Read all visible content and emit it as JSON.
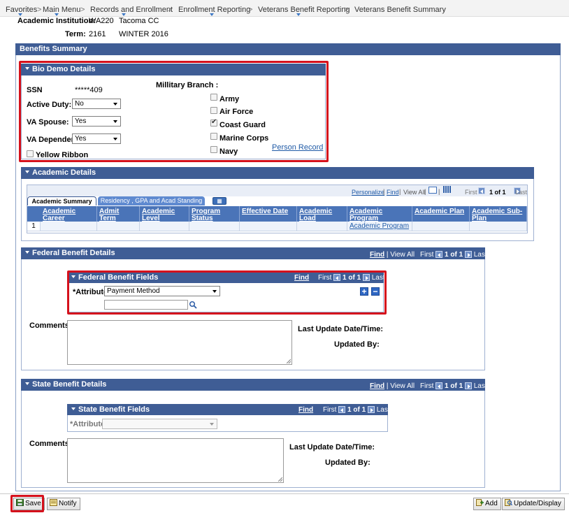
{
  "breadcrumb": {
    "items": [
      "Favorites",
      "Main Menu",
      "Records and Enrollment",
      "Enrollment Reporting",
      "Veterans Benefit Reporting",
      "Veterans Benefit Summary"
    ],
    "separator": ">"
  },
  "header": {
    "institution_label": "Academic Institution:",
    "institution_code": "WA220",
    "institution_name": "Tacoma CC",
    "term_label": "Term:",
    "term_code": "2161",
    "term_name": "WINTER 2016"
  },
  "benefits_summary": {
    "title": "Benefits Summary"
  },
  "bio_demo": {
    "title": "Bio Demo Details",
    "ssn_label": "SSN",
    "ssn_value": "*****409",
    "active_duty_label": "Active Duty:",
    "active_duty_value": "No",
    "va_spouse_label": "VA Spouse:",
    "va_spouse_value": "Yes",
    "va_dependent_label": "VA Dependent:",
    "va_dependent_value": "Yes",
    "yellow_ribbon_label": "Yellow Ribbon",
    "yellow_ribbon_checked": false,
    "military_branch_label": "Millitary Branch :",
    "branches": [
      {
        "label": "Army",
        "checked": false
      },
      {
        "label": "Air Force",
        "checked": false
      },
      {
        "label": "Coast Guard",
        "checked": true
      },
      {
        "label": "Marine Corps",
        "checked": false
      },
      {
        "label": "Navy",
        "checked": false
      }
    ],
    "person_record_link": "Person Record"
  },
  "academic": {
    "title": "Academic Details",
    "toolbar": {
      "personalize": "Personalize",
      "find": "Find",
      "view_all": "View All",
      "first": "First",
      "range": "1 of 1",
      "last": "Last",
      "sep": "|"
    },
    "tabs": [
      "Academic Summary",
      "Residency , GPA and Acad Standing"
    ],
    "columns": [
      "Academic Career",
      "Admit Term",
      "Academic Level",
      "Program Status",
      "Effective Date",
      "Academic Load",
      "Academic Program",
      "Academic Plan",
      "Academic Sub-Plan"
    ],
    "rows": [
      {
        "num": "1",
        "cells": [
          "",
          "",
          "",
          "",
          "",
          "",
          "Academic Program",
          "",
          ""
        ]
      }
    ]
  },
  "federal": {
    "title": "Federal Benefit Details",
    "find": "Find",
    "view_all": "View All",
    "first": "First",
    "range": "1 of 1",
    "last": "Last",
    "sep": "|",
    "fields_title": "Federal Benefit Fields",
    "fields_find": "Find",
    "fields_first": "First",
    "fields_range": "1 of 1",
    "fields_last": "Last",
    "attribute_label": "*Attribute",
    "attribute_value": "Payment Method",
    "lookup_value": "",
    "comments_label": "Comments:",
    "last_update_label": "Last Update Date/Time:",
    "updated_by_label": "Updated By:"
  },
  "state": {
    "title": "State Benefit Details",
    "find": "Find",
    "view_all": "View All",
    "first": "First",
    "range": "1 of 1",
    "last": "Last",
    "sep": "|",
    "fields_title": "State Benefit Fields",
    "fields_find": "Find",
    "fields_first": "First",
    "fields_range": "1 of 1",
    "fields_last": "Last",
    "attribute_label": "*Attribute",
    "attribute_value": "",
    "comments_label": "Comments:",
    "last_update_label": "Last Update Date/Time:",
    "updated_by_label": "Updated By:"
  },
  "footer": {
    "save": "Save",
    "notify": "Notify",
    "add": "Add",
    "update_display": "Update/Display"
  },
  "colors": {
    "section_bar": "#3f5d95",
    "grid_header": "#4a74b8",
    "highlight": "#d5111c",
    "link": "#1f5aa6"
  }
}
